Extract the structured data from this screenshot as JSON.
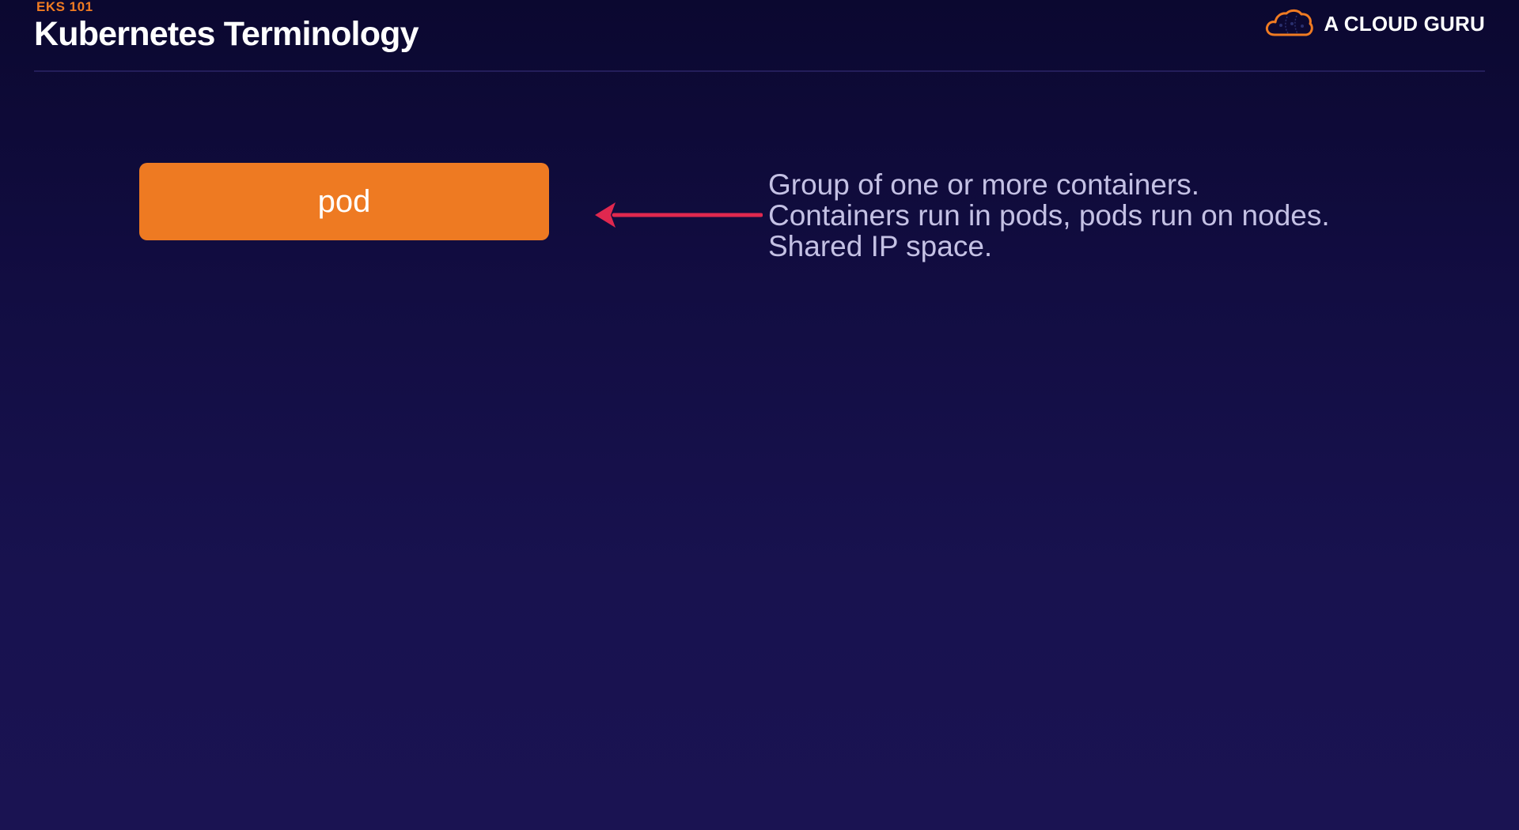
{
  "header": {
    "eyebrow": "EKS 101",
    "title": "Kubernetes Terminology"
  },
  "brand": {
    "name": "A CLOUD GURU",
    "logo_icon": "cloud-logo-icon"
  },
  "diagram": {
    "term": "pod",
    "arrow_icon": "left-arrow-icon",
    "description": [
      "Group of one or more containers.",
      "Containers run in pods, pods run on nodes.",
      "Shared IP space."
    ]
  },
  "colors": {
    "accent": "#ee7a22",
    "arrow": "#e0284f",
    "text_muted": "#c4c1e4",
    "background": "#120d42"
  }
}
